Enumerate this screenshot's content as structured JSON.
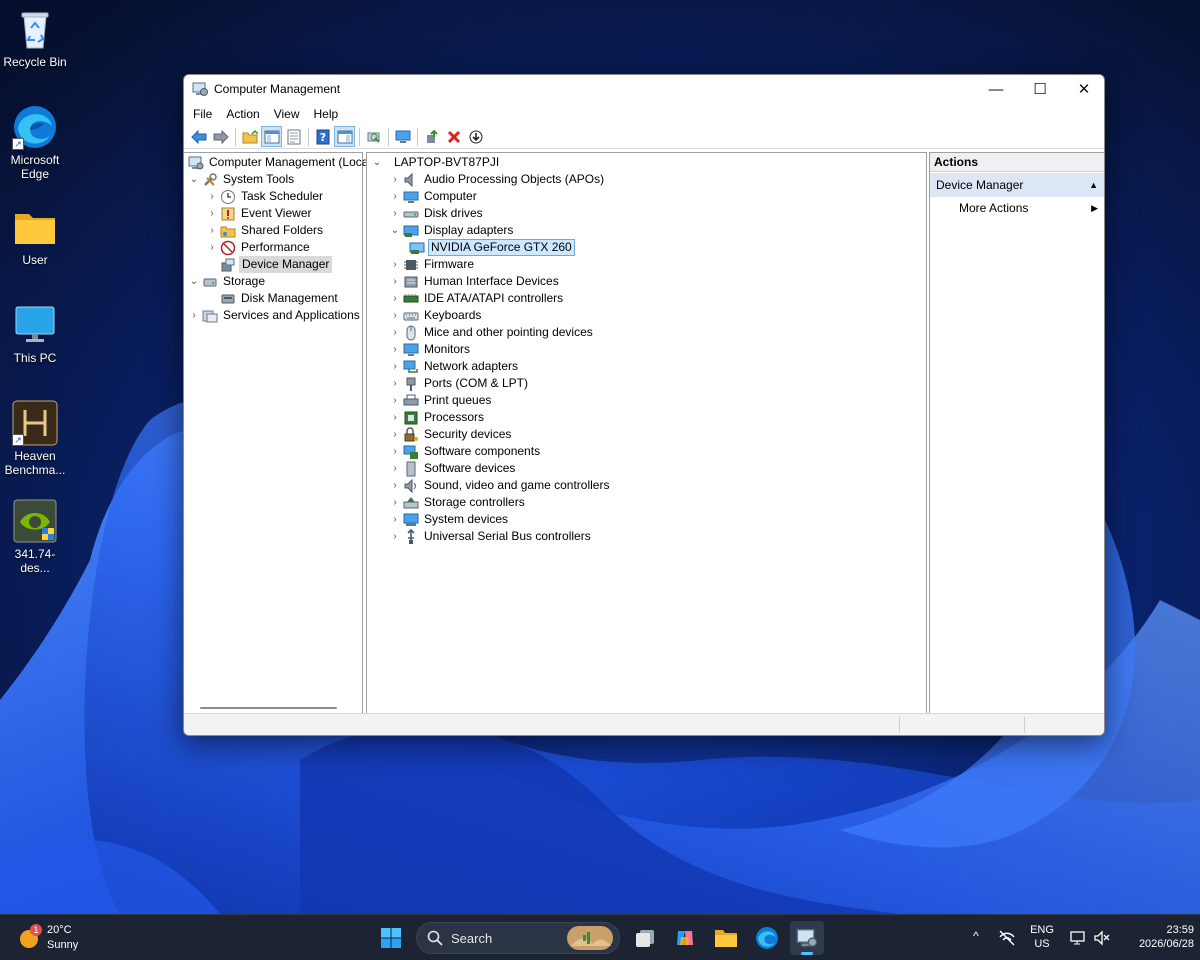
{
  "desktop": {
    "icons": [
      {
        "label": "Recycle Bin"
      },
      {
        "label": "Microsoft Edge"
      },
      {
        "label": "User"
      },
      {
        "label": "This PC"
      },
      {
        "label": "Heaven Benchma..."
      },
      {
        "label": "341.74-des..."
      }
    ]
  },
  "window": {
    "title": "Computer Management",
    "controls": {
      "minimize": "—",
      "maximize": "☐",
      "close": "✕"
    },
    "menu": [
      "File",
      "Action",
      "View",
      "Help"
    ]
  },
  "left_tree": {
    "root": "Computer Management (Local",
    "system_tools": "System Tools",
    "task_scheduler": "Task Scheduler",
    "event_viewer": "Event Viewer",
    "shared_folders": "Shared Folders",
    "performance": "Performance",
    "device_manager": "Device Manager",
    "storage": "Storage",
    "disk_management": "Disk Management",
    "services_apps": "Services and Applications"
  },
  "device_tree": {
    "root": "LAPTOP-BVT87PJI",
    "categories": [
      "Audio Processing Objects (APOs)",
      "Computer",
      "Disk drives",
      "Display adapters",
      "NVIDIA GeForce GTX 260",
      "Firmware",
      "Human Interface Devices",
      "IDE ATA/ATAPI controllers",
      "Keyboards",
      "Mice and other pointing devices",
      "Monitors",
      "Network adapters",
      "Ports (COM & LPT)",
      "Print queues",
      "Processors",
      "Security devices",
      "Software components",
      "Software devices",
      "Sound, video and game controllers",
      "Storage controllers",
      "System devices",
      "Universal Serial Bus controllers"
    ]
  },
  "actions": {
    "header": "Actions",
    "section": "Device Manager",
    "more": "More Actions"
  },
  "taskbar": {
    "weather_temp": "20°C",
    "weather_desc": "Sunny",
    "weather_badge": "1",
    "search_label": "Search",
    "lang_top": "ENG",
    "lang_bottom": "US",
    "time": "23:59",
    "date": "2026/06/28"
  },
  "colors": {
    "accent": "#0078d4",
    "selection": "#cce8ff",
    "taskbar": "#1c2433"
  }
}
